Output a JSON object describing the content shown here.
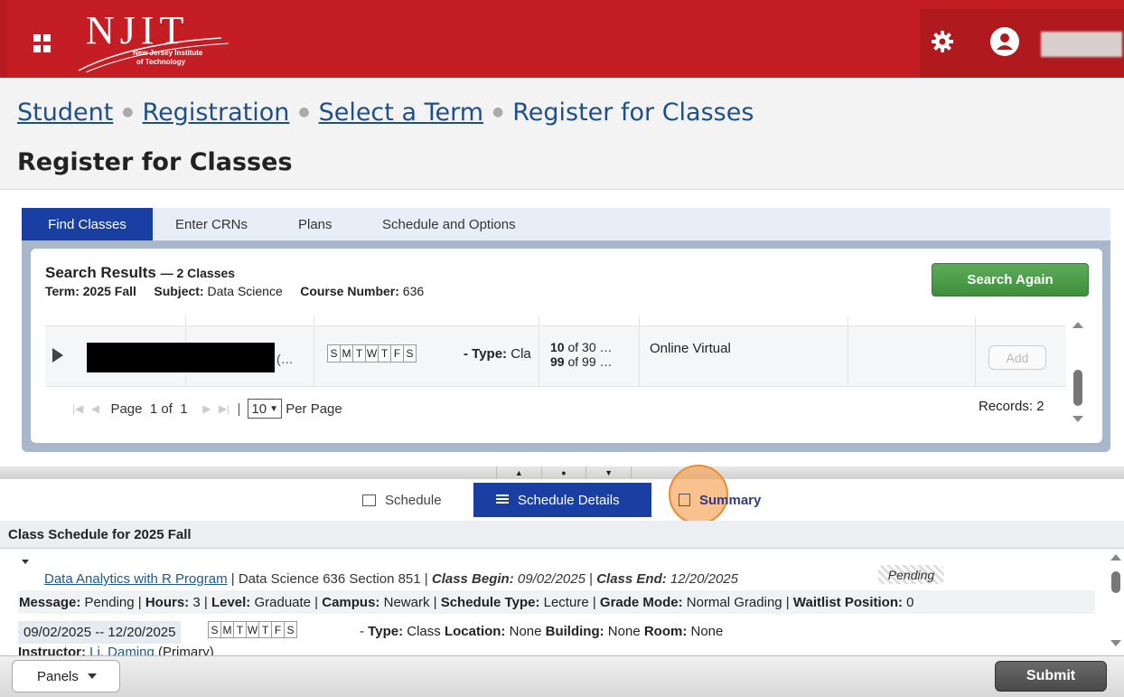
{
  "header": {
    "logo_text": "NJIT",
    "logo_line1": "New Jersey Institute",
    "logo_line2": "of Technology"
  },
  "breadcrumb": {
    "items": [
      "Student",
      "Registration",
      "Select a Term"
    ],
    "current": "Register for Classes"
  },
  "page_title": "Register for Classes",
  "tabs": [
    "Find Classes",
    "Enter CRNs",
    "Plans",
    "Schedule and Options"
  ],
  "search_results": {
    "title": "Search Results",
    "count": "— 2 Classes",
    "term_label": "Term:",
    "term_value": "2025 Fall",
    "subject_label": "Subject:",
    "subject_value": "Data Science",
    "course_label": "Course Number:",
    "course_value": "636",
    "search_again": "Search Again"
  },
  "result_row": {
    "title_suffix": "(…",
    "days": [
      "S",
      "M",
      "T",
      "W",
      "T",
      "F",
      "S"
    ],
    "type_label": "- Type:",
    "type_value": "Cla",
    "seats_1_num": "10",
    "seats_1_rest": "of 30 …",
    "seats_2_num": "99",
    "seats_2_rest": "of 99 …",
    "campus": "Online Virtual",
    "add": "Add"
  },
  "pager": {
    "page_label": "Page",
    "page_num": "1",
    "of_label": "of",
    "total_pages": "1",
    "per_page_value": "10",
    "per_page_label": "Per Page",
    "records": "Records: 2"
  },
  "lower_tabs": {
    "schedule": "Schedule",
    "schedule_details": "Schedule Details",
    "summary": "Summary"
  },
  "class_schedule": {
    "header": "Class Schedule for 2025 Fall",
    "course_link": "Data Analytics with R Program",
    "course_info": "| Data Science 636 Section 851 |",
    "class_begin_label": "Class Begin:",
    "class_begin": "09/02/2025",
    "class_end_label": "Class End:",
    "class_end": "12/20/2025",
    "status": "Pending",
    "message_label": "Message:",
    "message": "Pending",
    "hours_label": "Hours:",
    "hours": "3",
    "level_label": "Level:",
    "level": "Graduate",
    "campus_label": "Campus:",
    "campus": "Newark",
    "sched_type_label": "Schedule Type:",
    "sched_type": "Lecture",
    "grade_mode_label": "Grade Mode:",
    "grade_mode": "Normal Grading",
    "waitlist_label": "Waitlist Position:",
    "waitlist": "0",
    "date_range": "09/02/2025 -- 12/20/2025",
    "days": [
      "S",
      "M",
      "T",
      "W",
      "T",
      "F",
      "S"
    ],
    "type_label": "Type:",
    "type": "Class",
    "location_label": "Location:",
    "location": "None",
    "building_label": "Building:",
    "building": "None",
    "room_label": "Room:",
    "room": "None",
    "instructor_label": "Instructor:",
    "instructor": "Li, Daming",
    "instructor_role": "(Primary)"
  },
  "footer": {
    "panels": "Panels",
    "submit": "Submit"
  },
  "colors": {
    "header_red": "#c41e24",
    "tab_active": "#1a3fa3",
    "search_green": "#4a9c48",
    "highlight_orange": "#f5a050"
  }
}
